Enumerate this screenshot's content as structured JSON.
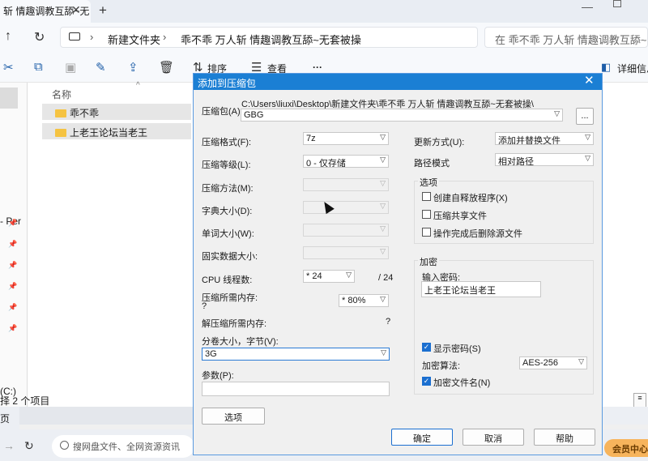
{
  "explorer": {
    "tab_title": "斩 情趣调教互舔~无",
    "tab_close": "✕",
    "tab_add": "+",
    "breadcrumb": [
      "新建文件夹",
      "乖不乖 万人斩 情趣调教互舔~无套被操"
    ],
    "search_placeholder": "在 乖不乖 万人斩 情趣调教互舔~无套被操",
    "toolbar": {
      "sort_label": "排序",
      "view_label": "查看",
      "more_label": "···",
      "details_label": "详细信息"
    },
    "column_name": "名称",
    "files": [
      "乖不乖",
      "上老王论坛当老王"
    ],
    "nav_partial": "- Per",
    "drive_partial": "(C:)",
    "status_text": "择 2 个项目",
    "page_label": "页",
    "net_search_placeholder": "搜网盘文件、全网资源资讯",
    "vip_label": "会员中心"
  },
  "dialog": {
    "title": "添加到压缩包",
    "archive_label": "压缩包(A):",
    "archive_path": "C:\\Users\\liuxi\\Desktop\\新建文件夹\\乖不乖 万人斩 情趣调教互舔~无套被操\\",
    "archive_name": "GBG",
    "browse_label": "...",
    "format_label": "压缩格式(F):",
    "format_value": "7z",
    "level_label": "压缩等级(L):",
    "level_value": "0 - 仅存储",
    "method_label": "压缩方法(M):",
    "dict_label": "字典大小(D):",
    "word_label": "单词大小(W):",
    "solid_label": "固实数据大小:",
    "cpu_label": "CPU 线程数:",
    "cpu_value": "* 24",
    "cpu_total": "/ 24",
    "mem_compress_label": "压缩所需内存:",
    "mem_compress_q": "?",
    "mem_value": "* 80%",
    "mem_decompress_label": "解压缩所需内存:",
    "mem_decompress_q": "?",
    "volume_label": "分卷大小，字节(V):",
    "volume_value": "3G",
    "params_label": "参数(P):",
    "params_value": "",
    "options_button": "选项",
    "update_label": "更新方式(U):",
    "update_value": "添加并替换文件",
    "path_label": "路径模式",
    "path_value": "相对路径",
    "options_group": "选项",
    "opt_sfx": "创建自释放程序(X)",
    "opt_shared": "压缩共享文件",
    "opt_delete": "操作完成后删除源文件",
    "encrypt_group": "加密",
    "password_label": "输入密码:",
    "password_value": "上老王论坛当老王",
    "show_password": "显示密码(S)",
    "enc_method_label": "加密算法:",
    "enc_method_value": "AES-256",
    "encrypt_names": "加密文件名(N)",
    "ok_button": "确定",
    "cancel_button": "取消",
    "help_button": "帮助"
  }
}
